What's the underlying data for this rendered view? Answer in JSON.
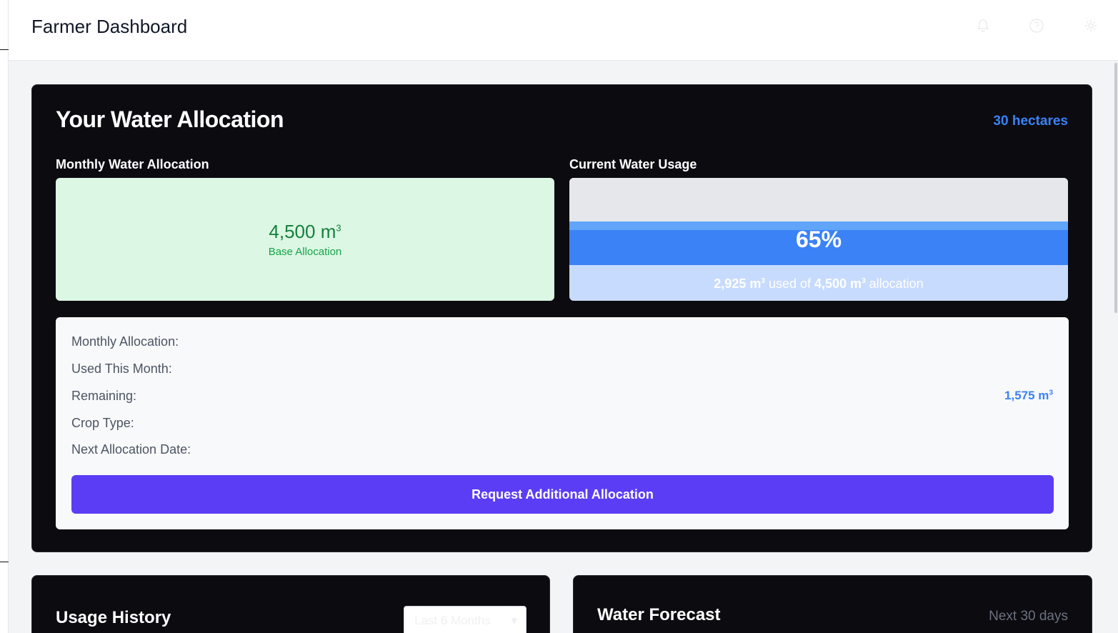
{
  "header": {
    "title": "Farmer Dashboard",
    "icons": [
      "bell-icon",
      "help-icon",
      "settings-icon"
    ]
  },
  "allocation": {
    "heading": "Your Water Allocation",
    "area": "30 hectares",
    "monthly_label": "Monthly Water Allocation",
    "monthly_value": "4,500 m",
    "monthly_unit_sup": "3",
    "monthly_caption": "Base Allocation",
    "usage_label": "Current Water Usage",
    "usage_percent": "65%",
    "usage_fraction": 0.65,
    "usage_used": "2,925 m",
    "usage_unit_sup": "3",
    "usage_mid": "used of",
    "usage_total": "4,500 m",
    "usage_end": "allocation"
  },
  "details": {
    "rows": [
      {
        "label": "Monthly Allocation:",
        "value": ""
      },
      {
        "label": "Used This Month:",
        "value": ""
      },
      {
        "label": "Remaining:",
        "value": "1,575 m",
        "sup": "3"
      },
      {
        "label": "Crop Type:",
        "value": ""
      },
      {
        "label": "Next Allocation Date:",
        "value": ""
      }
    ],
    "request_button": "Request Additional Allocation"
  },
  "usage_history": {
    "title": "Usage History",
    "range_select": "Last 6 Months"
  },
  "forecast": {
    "title": "Water Forecast",
    "range": "Next 30 days"
  },
  "colors": {
    "card_bg": "#0b0b10",
    "accent_blue": "#3b82f6",
    "allocation_green": "#dcf7e3",
    "button_purple": "#5b3df5"
  }
}
